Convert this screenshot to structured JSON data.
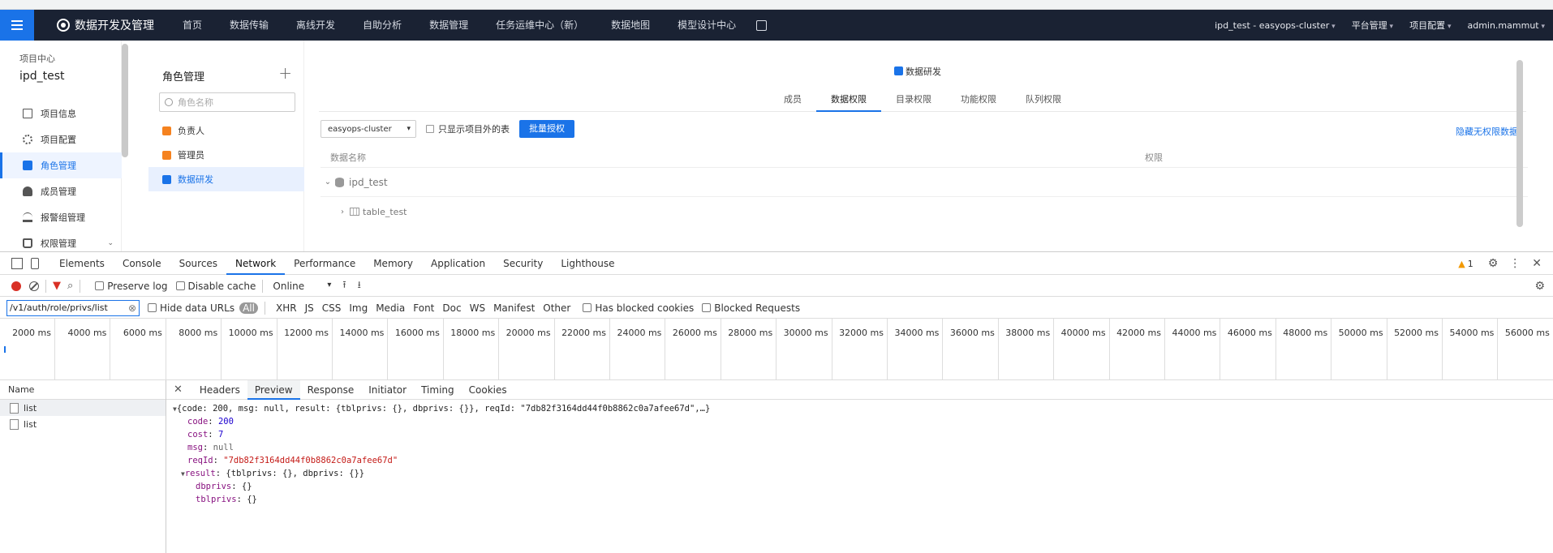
{
  "app": {
    "brand": "数据开发及管理",
    "nav": [
      "首页",
      "数据传输",
      "离线开发",
      "自助分析",
      "数据管理",
      "任务运维中心（新）",
      "数据地图",
      "模型设计中心"
    ],
    "right": [
      "ipd_test - easyops-cluster",
      "平台管理",
      "项目配置",
      "admin.mammut"
    ]
  },
  "sidebar": {
    "project_label": "项目中心",
    "project_name": "ipd_test",
    "items": [
      {
        "label": "项目信息",
        "icon": "document-icon"
      },
      {
        "label": "项目配置",
        "icon": "gear-icon"
      },
      {
        "label": "角色管理",
        "icon": "role-icon",
        "active": true
      },
      {
        "label": "成员管理",
        "icon": "user-icon"
      },
      {
        "label": "报警组管理",
        "icon": "alarm-icon"
      },
      {
        "label": "权限管理",
        "icon": "lock-icon"
      }
    ]
  },
  "roles": {
    "title": "角色管理",
    "add": "+",
    "search_placeholder": "角色名称",
    "items": [
      "负责人",
      "管理员",
      "数据研发"
    ],
    "active_index": 2
  },
  "main": {
    "header": "数据研发",
    "tabs": [
      "成员",
      "数据权限",
      "目录权限",
      "功能权限",
      "队列权限"
    ],
    "active_tab": 1,
    "cluster": "easyops-cluster",
    "checkbox_label": "只显示项目外的表",
    "batch_button": "批量授权",
    "hide_link": "隐藏无权限数据",
    "col_name": "数据名称",
    "col_perm": "权限",
    "db_row": "ipd_test",
    "table_row": "table_test"
  },
  "devtools": {
    "tabs": [
      "Elements",
      "Console",
      "Sources",
      "Network",
      "Performance",
      "Memory",
      "Application",
      "Security",
      "Lighthouse"
    ],
    "active_tab": "Network",
    "warnings": "1",
    "toolbar": {
      "preserve_log": "Preserve log",
      "disable_cache": "Disable cache",
      "throttle": "Online"
    },
    "filter": {
      "value": "/v1/auth/role/privs/list",
      "hide_data_urls": "Hide data URLs",
      "types": [
        "All",
        "XHR",
        "JS",
        "CSS",
        "Img",
        "Media",
        "Font",
        "Doc",
        "WS",
        "Manifest",
        "Other"
      ],
      "has_blocked": "Has blocked cookies",
      "blocked_requests": "Blocked Requests"
    },
    "ticks": [
      "2000 ms",
      "4000 ms",
      "6000 ms",
      "8000 ms",
      "10000 ms",
      "12000 ms",
      "14000 ms",
      "16000 ms",
      "18000 ms",
      "20000 ms",
      "22000 ms",
      "24000 ms",
      "26000 ms",
      "28000 ms",
      "30000 ms",
      "32000 ms",
      "34000 ms",
      "36000 ms",
      "38000 ms",
      "40000 ms",
      "42000 ms",
      "44000 ms",
      "46000 ms",
      "48000 ms",
      "50000 ms",
      "52000 ms",
      "54000 ms",
      "56000 ms"
    ],
    "requests_header": "Name",
    "requests": [
      "list",
      "list"
    ],
    "detail_tabs": [
      "Headers",
      "Preview",
      "Response",
      "Initiator",
      "Timing",
      "Cookies"
    ],
    "detail_active": "Preview",
    "preview": {
      "summary": "{code: 200, msg: null, result: {tblprivs: {}, dbprivs: {}}, reqId: \"7db82f3164dd44f0b8862c0a7afee67d\",…}",
      "code_key": "code",
      "code_val": "200",
      "cost_key": "cost",
      "cost_val": "7",
      "msg_key": "msg",
      "msg_val": "null",
      "reqid_key": "reqId",
      "reqid_val": "\"7db82f3164dd44f0b8862c0a7afee67d\"",
      "result_key": "result",
      "result_val": "{tblprivs: {}, dbprivs: {}}",
      "dbprivs_key": "dbprivs",
      "dbprivs_val": "{}",
      "tblprivs_key": "tblprivs",
      "tblprivs_val": "{}"
    }
  }
}
